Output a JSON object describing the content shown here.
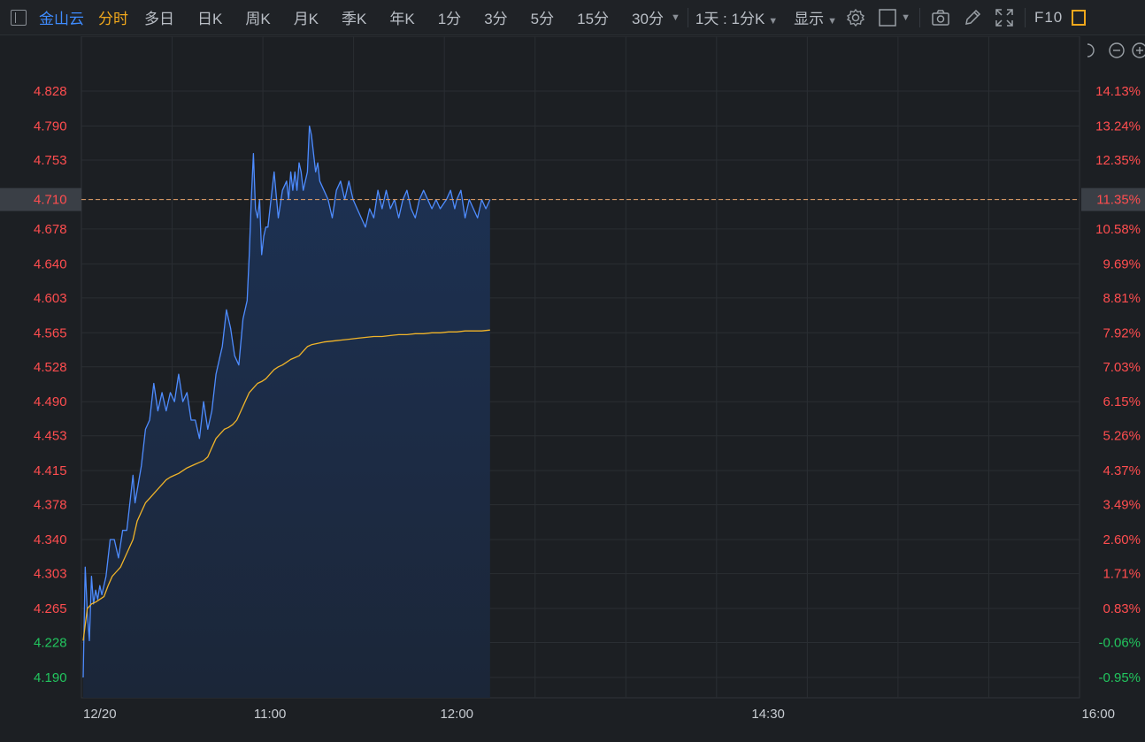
{
  "toolbar": {
    "stock_name": "金山云",
    "periods": [
      "分时",
      "多日",
      "日K",
      "周K",
      "月K",
      "季K",
      "年K",
      "1分",
      "3分",
      "5分",
      "15分",
      "30分"
    ],
    "active_period": "分时",
    "interval_select": "1天 : 1分K",
    "display_label": "显示",
    "f10_label": "F10",
    "icons": [
      "sidebar-toggle-icon",
      "settings-gear-icon",
      "checkbox-square-icon",
      "camera-icon",
      "pencil-icon",
      "fullscreen-icon"
    ]
  },
  "zoom_controls": [
    "reset-icon",
    "zoom-out-icon",
    "zoom-in-icon"
  ],
  "colors": {
    "up": "#ff4d4f",
    "down": "#22c55e",
    "price_line": "#4e8cff",
    "avg_line": "#f0b429",
    "current_marker": "#e8a36a",
    "grid": "#2a2e33",
    "area_fill": "#1a2a44"
  },
  "chart_data": {
    "type": "line",
    "prev_close": 4.231,
    "current_price": 4.71,
    "current_pct": "11.35%",
    "ylim": [
      4.18,
      4.845
    ],
    "y_ticks": [
      "4.828",
      "4.790",
      "4.753",
      "4.710",
      "4.678",
      "4.640",
      "4.603",
      "4.565",
      "4.528",
      "4.490",
      "4.453",
      "4.415",
      "4.378",
      "4.340",
      "4.303",
      "4.265",
      "4.228",
      "4.190"
    ],
    "y_pct_ticks": [
      "14.13%",
      "13.24%",
      "12.35%",
      "11.35%",
      "10.58%",
      "9.69%",
      "8.81%",
      "7.92%",
      "7.03%",
      "6.15%",
      "5.26%",
      "4.37%",
      "3.49%",
      "2.60%",
      "1.71%",
      "0.83%",
      "-0.06%",
      "-0.95%"
    ],
    "x_labels": [
      {
        "minute": 0,
        "label": "12/20"
      },
      {
        "minute": 90,
        "label": "11:00"
      },
      {
        "minute": 180,
        "label": "12:00"
      },
      {
        "minute": 330,
        "label": "14:30"
      },
      {
        "minute": 480,
        "label": "16:00"
      }
    ],
    "total_minutes": 480,
    "series": [
      {
        "name": "price",
        "points": [
          [
            0,
            4.19
          ],
          [
            1,
            4.31
          ],
          [
            2,
            4.26
          ],
          [
            3,
            4.23
          ],
          [
            4,
            4.3
          ],
          [
            5,
            4.27
          ],
          [
            6,
            4.285
          ],
          [
            7,
            4.275
          ],
          [
            8,
            4.29
          ],
          [
            9,
            4.28
          ],
          [
            11,
            4.3
          ],
          [
            13,
            4.34
          ],
          [
            15,
            4.34
          ],
          [
            17,
            4.32
          ],
          [
            19,
            4.35
          ],
          [
            21,
            4.35
          ],
          [
            24,
            4.41
          ],
          [
            25,
            4.38
          ],
          [
            28,
            4.42
          ],
          [
            30,
            4.46
          ],
          [
            32,
            4.47
          ],
          [
            34,
            4.51
          ],
          [
            36,
            4.48
          ],
          [
            38,
            4.5
          ],
          [
            40,
            4.48
          ],
          [
            42,
            4.5
          ],
          [
            44,
            4.49
          ],
          [
            46,
            4.52
          ],
          [
            48,
            4.49
          ],
          [
            50,
            4.5
          ],
          [
            52,
            4.47
          ],
          [
            54,
            4.47
          ],
          [
            56,
            4.45
          ],
          [
            58,
            4.49
          ],
          [
            60,
            4.46
          ],
          [
            62,
            4.48
          ],
          [
            64,
            4.52
          ],
          [
            66,
            4.54
          ],
          [
            67,
            4.55
          ],
          [
            69,
            4.59
          ],
          [
            71,
            4.57
          ],
          [
            73,
            4.54
          ],
          [
            75,
            4.53
          ],
          [
            77,
            4.58
          ],
          [
            79,
            4.6
          ],
          [
            80,
            4.65
          ],
          [
            81,
            4.71
          ],
          [
            82,
            4.76
          ],
          [
            83,
            4.7
          ],
          [
            84,
            4.69
          ],
          [
            85,
            4.71
          ],
          [
            86,
            4.65
          ],
          [
            87,
            4.67
          ],
          [
            88,
            4.68
          ],
          [
            89,
            4.68
          ],
          [
            90,
            4.7
          ],
          [
            92,
            4.74
          ],
          [
            94,
            4.69
          ],
          [
            96,
            4.72
          ],
          [
            98,
            4.73
          ],
          [
            99,
            4.71
          ],
          [
            100,
            4.74
          ],
          [
            101,
            4.72
          ],
          [
            102,
            4.74
          ],
          [
            103,
            4.72
          ],
          [
            104,
            4.75
          ],
          [
            105,
            4.74
          ],
          [
            106,
            4.72
          ],
          [
            108,
            4.74
          ],
          [
            109,
            4.79
          ],
          [
            110,
            4.78
          ],
          [
            112,
            4.74
          ],
          [
            113,
            4.75
          ],
          [
            114,
            4.73
          ],
          [
            116,
            4.72
          ],
          [
            118,
            4.71
          ],
          [
            120,
            4.69
          ],
          [
            122,
            4.72
          ],
          [
            124,
            4.73
          ],
          [
            126,
            4.71
          ],
          [
            128,
            4.73
          ],
          [
            130,
            4.71
          ],
          [
            132,
            4.7
          ],
          [
            134,
            4.69
          ],
          [
            136,
            4.68
          ],
          [
            138,
            4.7
          ],
          [
            140,
            4.69
          ],
          [
            142,
            4.72
          ],
          [
            144,
            4.7
          ],
          [
            146,
            4.72
          ],
          [
            148,
            4.7
          ],
          [
            150,
            4.71
          ],
          [
            152,
            4.69
          ],
          [
            154,
            4.71
          ],
          [
            156,
            4.72
          ],
          [
            158,
            4.7
          ],
          [
            160,
            4.69
          ],
          [
            162,
            4.71
          ],
          [
            164,
            4.72
          ],
          [
            166,
            4.71
          ],
          [
            168,
            4.7
          ],
          [
            170,
            4.71
          ],
          [
            172,
            4.7
          ],
          [
            175,
            4.71
          ],
          [
            177,
            4.72
          ],
          [
            179,
            4.7
          ],
          [
            180,
            4.71
          ],
          [
            182,
            4.72
          ],
          [
            184,
            4.69
          ],
          [
            186,
            4.71
          ],
          [
            188,
            4.7
          ],
          [
            190,
            4.69
          ],
          [
            192,
            4.71
          ],
          [
            194,
            4.7
          ],
          [
            196,
            4.71
          ]
        ]
      },
      {
        "name": "average",
        "points": [
          [
            0,
            4.23
          ],
          [
            2,
            4.265
          ],
          [
            4,
            4.27
          ],
          [
            6,
            4.272
          ],
          [
            8,
            4.275
          ],
          [
            10,
            4.278
          ],
          [
            12,
            4.29
          ],
          [
            14,
            4.3
          ],
          [
            16,
            4.305
          ],
          [
            18,
            4.31
          ],
          [
            20,
            4.32
          ],
          [
            22,
            4.33
          ],
          [
            24,
            4.34
          ],
          [
            26,
            4.36
          ],
          [
            28,
            4.37
          ],
          [
            30,
            4.38
          ],
          [
            32,
            4.385
          ],
          [
            34,
            4.39
          ],
          [
            36,
            4.395
          ],
          [
            38,
            4.4
          ],
          [
            40,
            4.405
          ],
          [
            42,
            4.408
          ],
          [
            44,
            4.41
          ],
          [
            46,
            4.412
          ],
          [
            48,
            4.415
          ],
          [
            50,
            4.418
          ],
          [
            52,
            4.42
          ],
          [
            54,
            4.422
          ],
          [
            56,
            4.424
          ],
          [
            58,
            4.426
          ],
          [
            60,
            4.43
          ],
          [
            62,
            4.44
          ],
          [
            64,
            4.45
          ],
          [
            66,
            4.455
          ],
          [
            68,
            4.46
          ],
          [
            70,
            4.462
          ],
          [
            72,
            4.465
          ],
          [
            74,
            4.47
          ],
          [
            76,
            4.48
          ],
          [
            78,
            4.49
          ],
          [
            80,
            4.5
          ],
          [
            82,
            4.505
          ],
          [
            84,
            4.51
          ],
          [
            86,
            4.512
          ],
          [
            88,
            4.515
          ],
          [
            90,
            4.52
          ],
          [
            92,
            4.525
          ],
          [
            94,
            4.528
          ],
          [
            96,
            4.53
          ],
          [
            98,
            4.533
          ],
          [
            100,
            4.536
          ],
          [
            102,
            4.538
          ],
          [
            104,
            4.54
          ],
          [
            106,
            4.545
          ],
          [
            108,
            4.55
          ],
          [
            110,
            4.552
          ],
          [
            112,
            4.553
          ],
          [
            114,
            4.554
          ],
          [
            116,
            4.555
          ],
          [
            120,
            4.556
          ],
          [
            124,
            4.557
          ],
          [
            128,
            4.558
          ],
          [
            132,
            4.559
          ],
          [
            136,
            4.56
          ],
          [
            140,
            4.561
          ],
          [
            144,
            4.561
          ],
          [
            148,
            4.562
          ],
          [
            152,
            4.563
          ],
          [
            156,
            4.563
          ],
          [
            160,
            4.564
          ],
          [
            164,
            4.564
          ],
          [
            168,
            4.565
          ],
          [
            172,
            4.565
          ],
          [
            176,
            4.566
          ],
          [
            180,
            4.566
          ],
          [
            184,
            4.567
          ],
          [
            188,
            4.567
          ],
          [
            192,
            4.567
          ],
          [
            196,
            4.568
          ]
        ]
      }
    ]
  }
}
